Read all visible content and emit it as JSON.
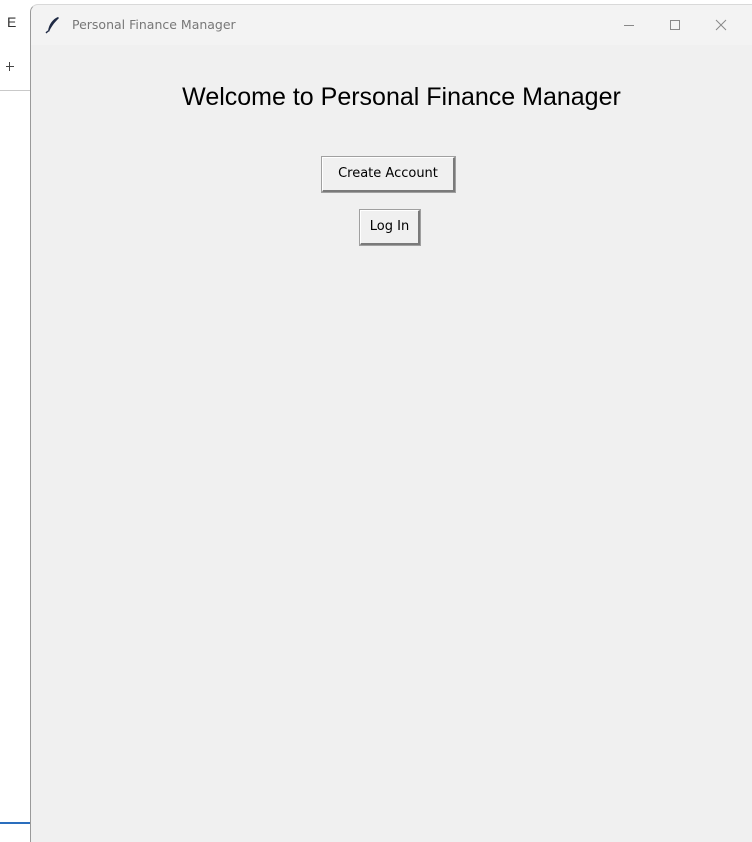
{
  "background": {
    "letter": "E"
  },
  "window": {
    "title": "Personal Finance Manager",
    "icon": "feather-icon",
    "controls": {
      "minimize": "minimize-icon",
      "maximize": "maximize-icon",
      "close": "close-icon"
    }
  },
  "main": {
    "heading": "Welcome to Personal Finance Manager",
    "create_account_label": "Create Account",
    "log_in_label": "Log In"
  },
  "colors": {
    "window_bg": "#f0f0f0",
    "title_text": "#777777",
    "heading_text": "#000000"
  }
}
